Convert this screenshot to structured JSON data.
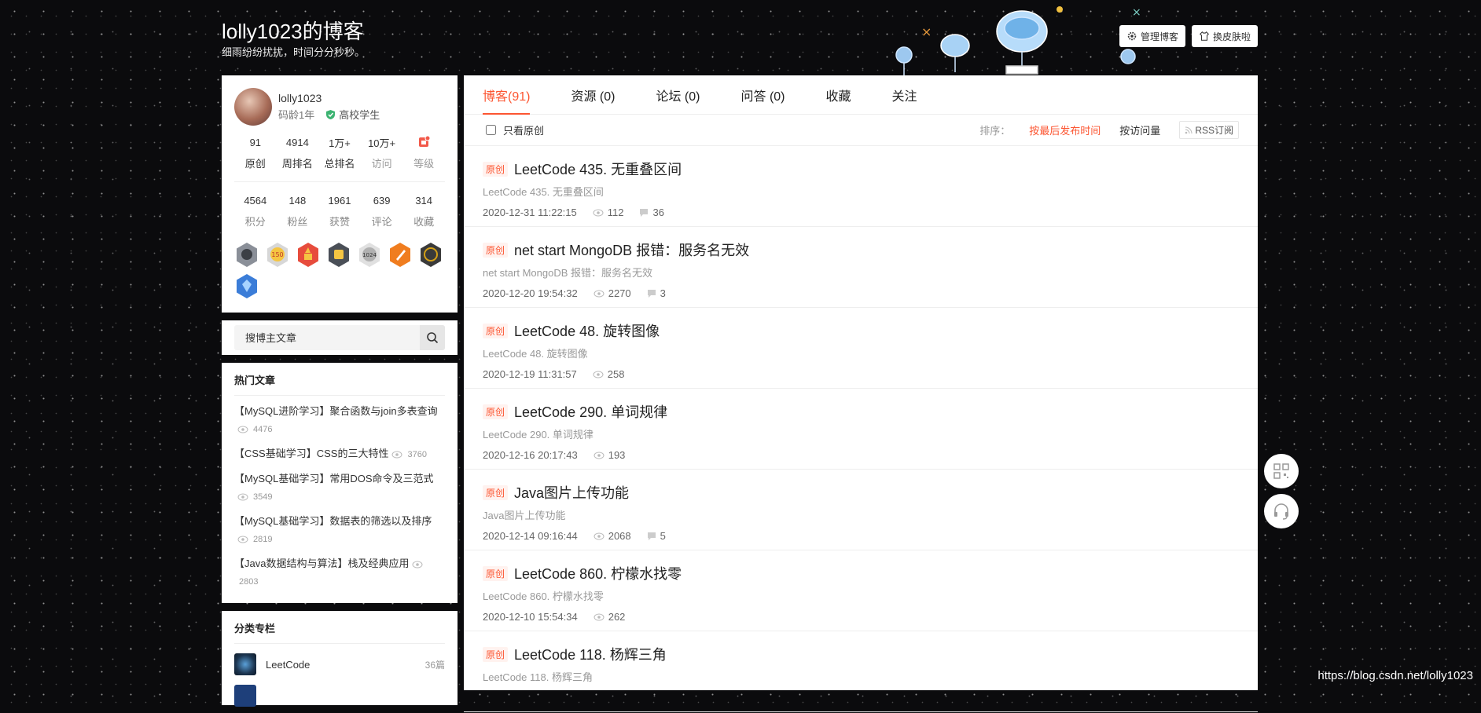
{
  "header": {
    "title": "lolly1023的博客",
    "motto": "细雨纷纷扰扰，时间分分秒秒。",
    "manage_label": "管理博客",
    "skin_label": "换皮肤啦"
  },
  "profile": {
    "name": "lolly1023",
    "code_age": "码龄1年",
    "identity": "高校学生",
    "stats_row1": [
      {
        "value": "91",
        "label": "原创"
      },
      {
        "value": "4914",
        "label": "周排名"
      },
      {
        "value": "1万+",
        "label": "总排名"
      },
      {
        "value": "10万+",
        "label": "访问"
      },
      {
        "value": "",
        "label": "等级"
      }
    ],
    "stats_row2": [
      {
        "value": "4564",
        "label": "积分"
      },
      {
        "value": "148",
        "label": "粉丝"
      },
      {
        "value": "1961",
        "label": "获赞"
      },
      {
        "value": "639",
        "label": "评论"
      },
      {
        "value": "314",
        "label": "收藏"
      }
    ]
  },
  "search": {
    "placeholder": "搜博主文章"
  },
  "hot": {
    "title": "热门文章",
    "items": [
      {
        "title": "【MySQL进阶学习】聚合函数与join多表查询",
        "views": "4476"
      },
      {
        "title": "【CSS基础学习】CSS的三大特性",
        "views": "3760"
      },
      {
        "title": "【MySQL基础学习】常用DOS命令及三范式",
        "views": "3549"
      },
      {
        "title": "【MySQL基础学习】数据表的筛选以及排序",
        "views": "2819"
      },
      {
        "title": "【Java数据结构与算法】栈及经典应用",
        "views": "2803"
      }
    ]
  },
  "columns": {
    "title": "分类专栏",
    "items": [
      {
        "name": "LeetCode",
        "count": "36篇"
      }
    ]
  },
  "tabs": [
    {
      "label": "博客(91)"
    },
    {
      "label": "资源 (0)"
    },
    {
      "label": "论坛 (0)"
    },
    {
      "label": "问答 (0)"
    },
    {
      "label": "收藏"
    },
    {
      "label": "关注"
    }
  ],
  "filter": {
    "only_original": "只看原创",
    "sort_label": "排序：",
    "sort_latest": "按最后发布时间",
    "sort_views": "按访问量",
    "rss": "RSS订阅"
  },
  "articles": [
    {
      "tag": "原创",
      "title": "LeetCode 435. 无重叠区间",
      "desc": "LeetCode 435. 无重叠区间",
      "date": "2020-12-31 11:22:15",
      "views": "112",
      "comments": "36"
    },
    {
      "tag": "原创",
      "title": "net start MongoDB 报错：服务名无效",
      "desc": "net start MongoDB 报错：服务名无效",
      "date": "2020-12-20 19:54:32",
      "views": "2270",
      "comments": "3"
    },
    {
      "tag": "原创",
      "title": "LeetCode 48. 旋转图像",
      "desc": "LeetCode 48. 旋转图像",
      "date": "2020-12-19 11:31:57",
      "views": "258",
      "comments": null
    },
    {
      "tag": "原创",
      "title": "LeetCode 290. 单词规律",
      "desc": "LeetCode 290. 单词规律",
      "date": "2020-12-16 20:17:43",
      "views": "193",
      "comments": null
    },
    {
      "tag": "原创",
      "title": "Java图片上传功能",
      "desc": "Java图片上传功能",
      "date": "2020-12-14 09:16:44",
      "views": "2068",
      "comments": "5"
    },
    {
      "tag": "原创",
      "title": "LeetCode 860. 柠檬水找零",
      "desc": "LeetCode 860. 柠檬水找零",
      "date": "2020-12-10 15:54:34",
      "views": "262",
      "comments": null
    },
    {
      "tag": "原创",
      "title": "LeetCode 118. 杨辉三角",
      "desc": "LeetCode 118. 杨辉三角",
      "date": "",
      "views": "",
      "comments": null
    }
  ],
  "watermark": "https://blog.csdn.net/lolly1023",
  "colors": {
    "accent": "#fc5531",
    "background": "#0b0b0d"
  },
  "icons": {
    "manage": "gear-icon",
    "skin": "shirt-icon",
    "search": "search-icon",
    "views": "eye-icon",
    "comments": "comment-icon",
    "qr": "qr-code-icon",
    "support": "headset-icon"
  }
}
